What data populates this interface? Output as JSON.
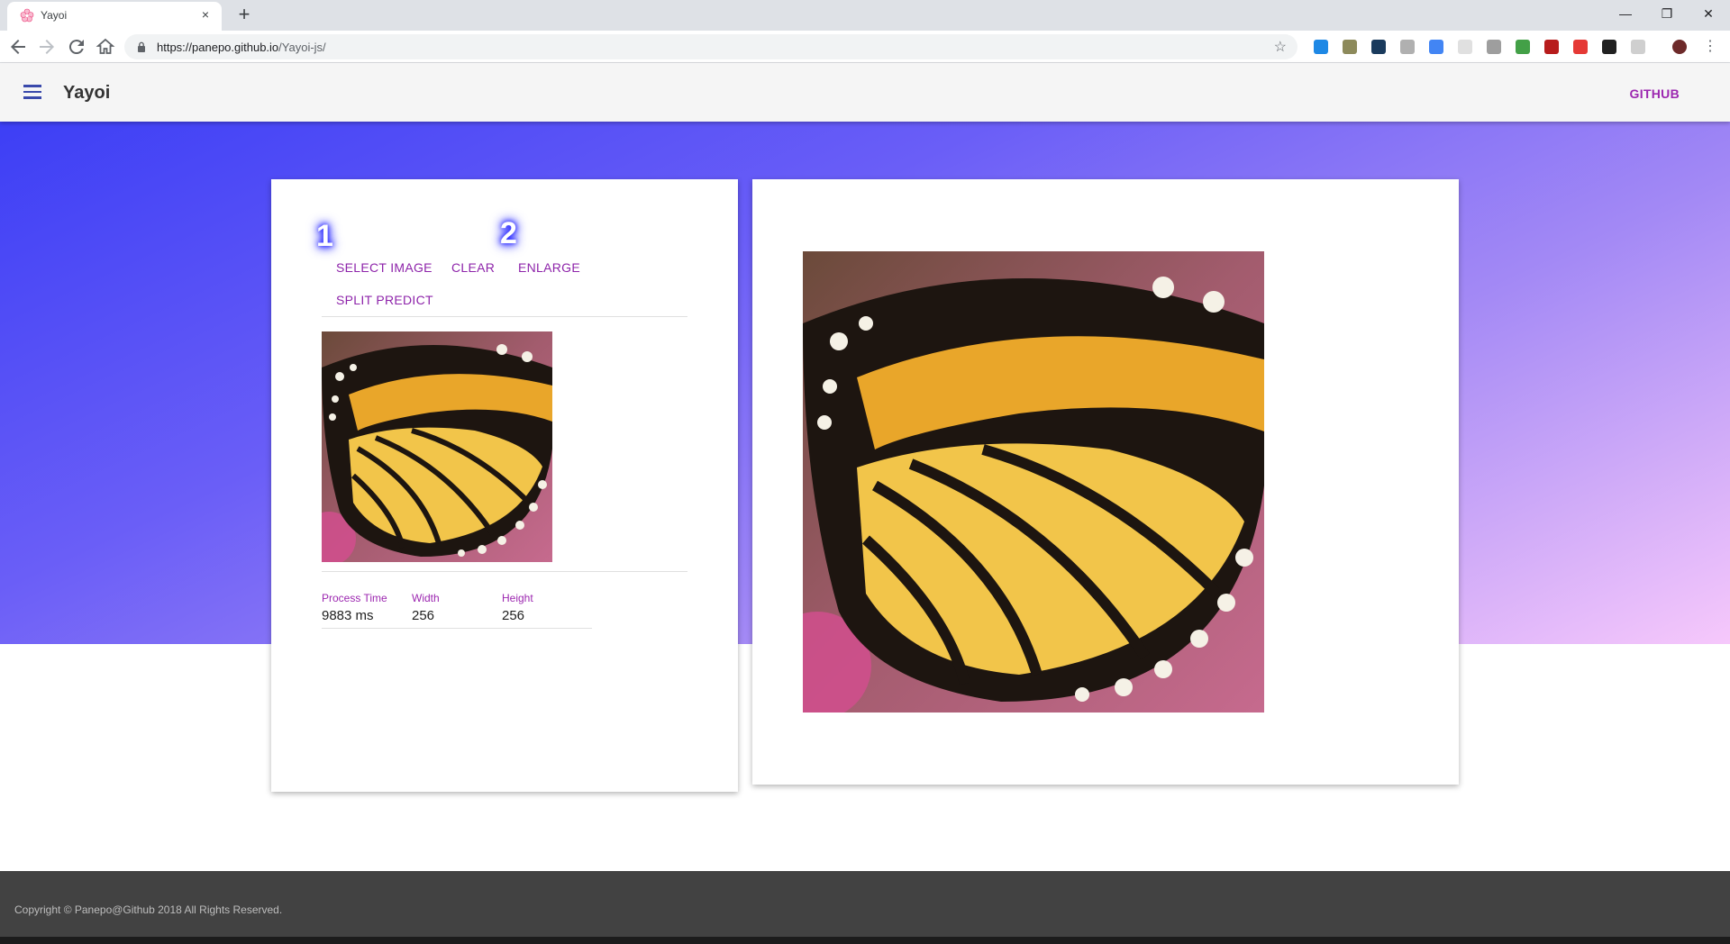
{
  "browser": {
    "tab_title": "Yayoi",
    "tab_close": "×",
    "new_tab": "+",
    "url_host": "https://panepo.github.io",
    "url_path": "/Yayoi-js/",
    "window_controls": {
      "minimize": "—",
      "restore": "❐",
      "close": "✕"
    }
  },
  "header": {
    "title": "Yayoi",
    "github_label": "GITHUB"
  },
  "controls": {
    "select_image": "SELECT IMAGE",
    "clear": "CLEAR",
    "enlarge": "ENLARGE",
    "split_predict": "SPLIT PREDICT",
    "marker_1": "1",
    "marker_2": "2"
  },
  "stats": {
    "process_time": {
      "label": "Process Time",
      "value": "9883 ms"
    },
    "width": {
      "label": "Width",
      "value": "256"
    },
    "height": {
      "label": "Height",
      "value": "256"
    }
  },
  "footer": {
    "copyright": "Copyright © Panepo@Github 2018 All Rights Reserved."
  },
  "colors": {
    "accent": "#9c27b0",
    "hero_start": "#3d3ff5",
    "hero_end": "#f6c8fb",
    "footer_bg": "#424242"
  },
  "icons": [
    "back-icon",
    "forward-icon",
    "reload-icon",
    "home-icon",
    "lock-icon",
    "star-icon",
    "hamburger-menu-icon",
    "cherry-blossom-icon"
  ]
}
